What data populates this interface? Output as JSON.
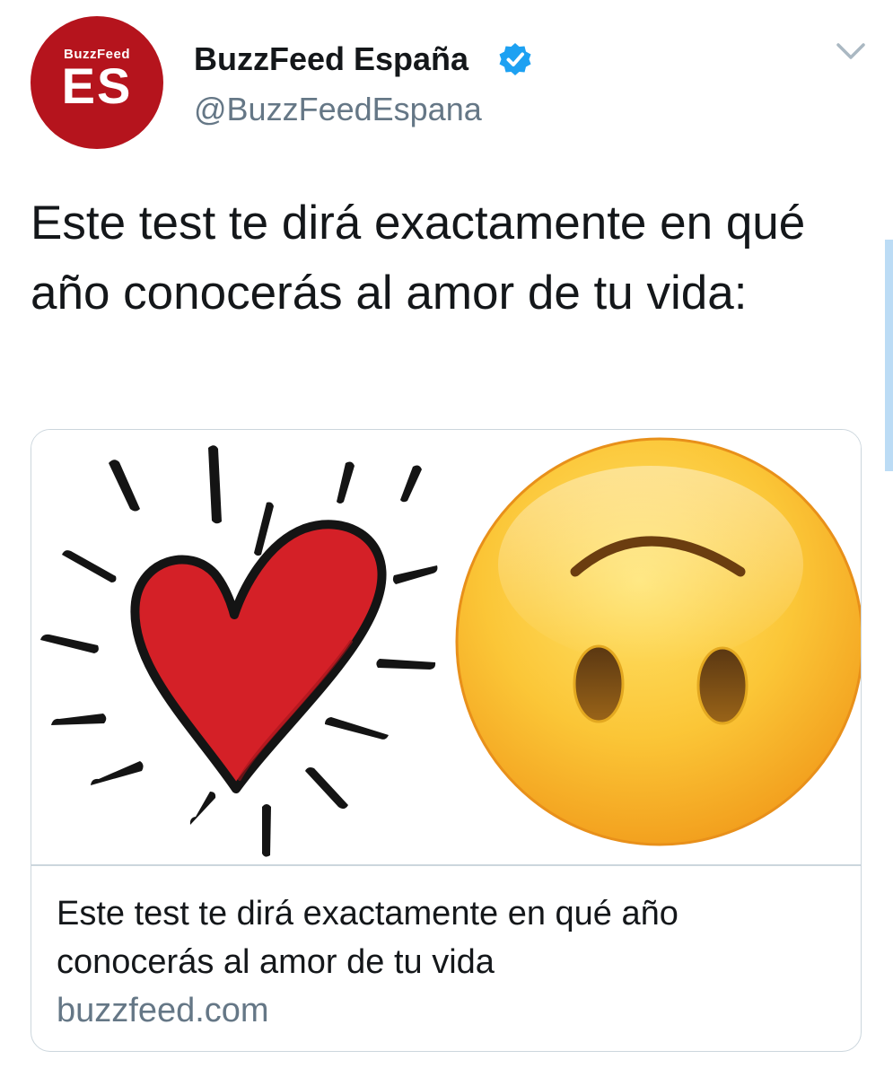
{
  "author": {
    "avatar_brand": "BuzzFeed",
    "avatar_code": "ES",
    "display_name": "BuzzFeed España",
    "handle": "@BuzzFeedEspana",
    "verified": true
  },
  "tweet": {
    "text": "Este test te dirá exactamente en qué año conocerás al amor de tu vida:"
  },
  "card": {
    "image_alt_icons": [
      "heart-icon",
      "upside-down-face-emoji"
    ],
    "title": "Este test te dirá exactamente en qué año conocerás al amor de tu vida",
    "domain": "buzzfeed.com"
  },
  "icons": {
    "verified": "verified-badge-icon",
    "menu": "chevron-down-icon"
  },
  "colors": {
    "brand_red": "#b5141d",
    "verified_blue": "#1da1f2",
    "text_primary": "#14171a",
    "text_secondary": "#657786",
    "heart_red": "#d42027",
    "emoji_yellow": "#f7b52b"
  }
}
